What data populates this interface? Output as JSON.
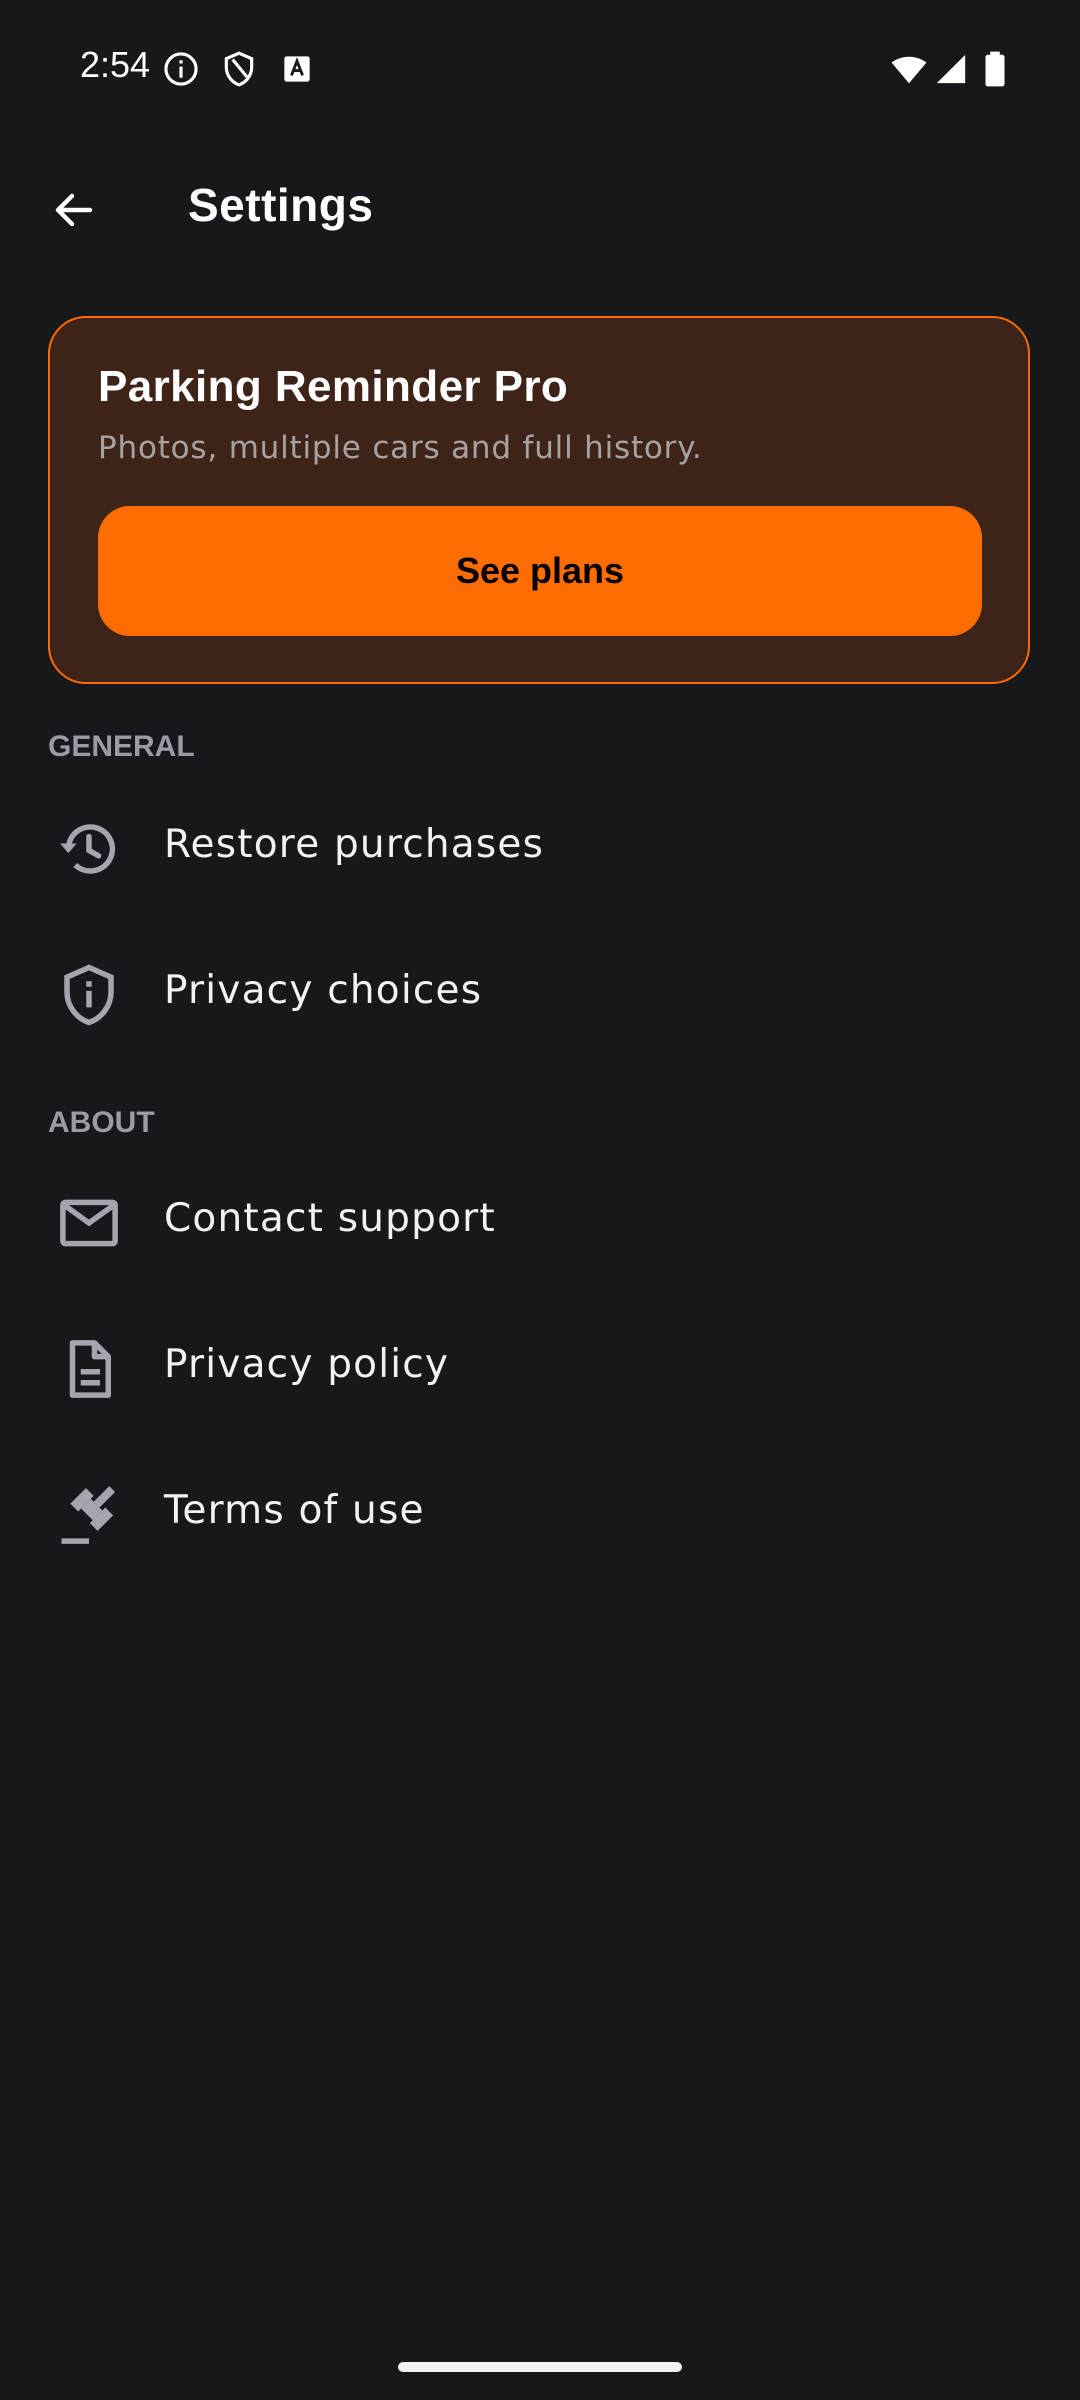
{
  "status_bar": {
    "time": "2:54",
    "icons": [
      "info-icon",
      "shield-icon",
      "text-badge-icon",
      "wifi-icon",
      "signal-icon",
      "battery-icon"
    ]
  },
  "top_bar": {
    "title": "Settings",
    "back_icon": "arrow-left-icon"
  },
  "pro_card": {
    "title": "Parking Reminder Pro",
    "subtitle": "Photos, multiple cars and full history.",
    "button_label": "See plans",
    "accent_color": "#ff6c00",
    "background_color": "#3e2418"
  },
  "sections": {
    "general": {
      "header": "GENERAL",
      "items": [
        {
          "label": "Restore purchases",
          "icon": "restore-history-icon"
        },
        {
          "label": "Privacy choices",
          "icon": "shield-info-icon"
        }
      ]
    },
    "about": {
      "header": "ABOUT",
      "items": [
        {
          "label": "Contact support",
          "icon": "mail-icon"
        },
        {
          "label": "Privacy policy",
          "icon": "document-icon"
        },
        {
          "label": "Terms of use",
          "icon": "gavel-icon"
        }
      ]
    }
  },
  "colors": {
    "background": "#17181c",
    "section_header": "#9a9ca4",
    "icon": "#a4a6ae"
  }
}
